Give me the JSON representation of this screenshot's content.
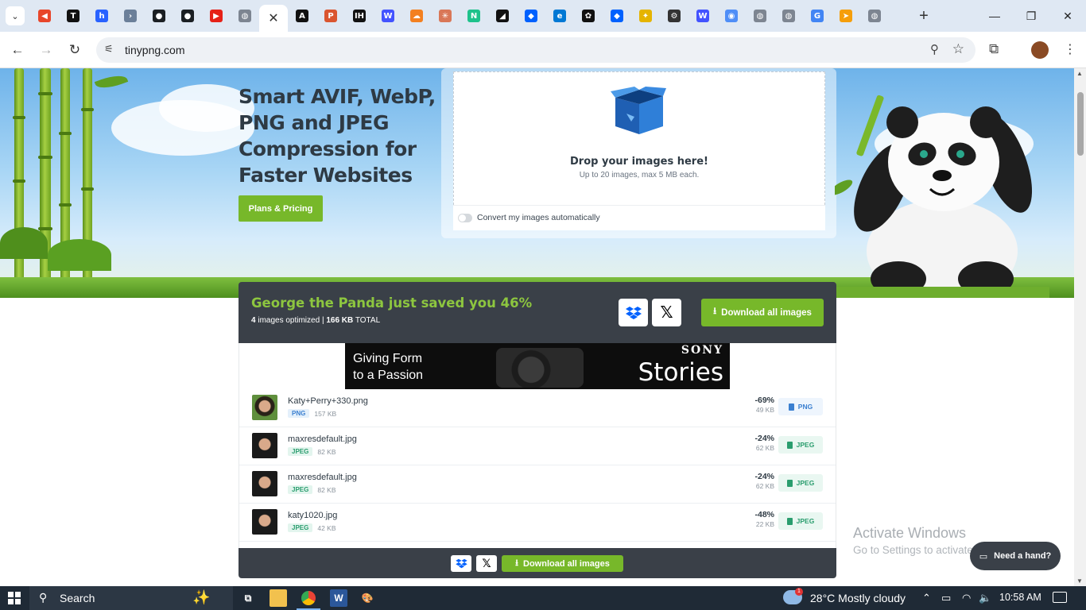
{
  "browser": {
    "tabs": [
      {
        "icon": "tab-menu-icon",
        "glyph": "⌄",
        "color": "#ffffff"
      },
      {
        "icon": "bookmark-red-icon",
        "glyph": "◀",
        "color": "#e8462a"
      },
      {
        "icon": "tabnine-icon",
        "glyph": "T",
        "color": "#111111"
      },
      {
        "icon": "hashnode-icon",
        "glyph": "h",
        "color": "#2962ff"
      },
      {
        "icon": "chevron-icon",
        "glyph": "›",
        "color": "#6b7f99"
      },
      {
        "icon": "github-icon",
        "glyph": "●",
        "color": "#1b1f23"
      },
      {
        "icon": "github-icon",
        "glyph": "●",
        "color": "#1b1f23"
      },
      {
        "icon": "youtube-icon",
        "glyph": "▶",
        "color": "#e62117"
      },
      {
        "icon": "globe-icon",
        "glyph": "◍",
        "color": "#7d8591"
      },
      {
        "icon": "x-icon",
        "glyph": "X",
        "color": "#000000"
      },
      {
        "icon": "anthropic-icon",
        "glyph": "A",
        "color": "#111111"
      },
      {
        "icon": "producthunt-icon",
        "glyph": "P",
        "color": "#da552f"
      },
      {
        "icon": "indiehackers-icon",
        "glyph": "IH",
        "color": "#111111"
      },
      {
        "icon": "webflow-icon",
        "glyph": "W",
        "color": "#4353ff"
      },
      {
        "icon": "cloud-orange-icon",
        "glyph": "☁",
        "color": "#f38020"
      },
      {
        "icon": "asterisk-icon",
        "glyph": "✳",
        "color": "#d97757"
      },
      {
        "icon": "n-logo-icon",
        "glyph": "N",
        "color": "#1ec28b"
      },
      {
        "icon": "slash-icon",
        "glyph": "◢",
        "color": "#111111"
      },
      {
        "icon": "dropbox-icon",
        "glyph": "◆",
        "color": "#0061fe"
      },
      {
        "icon": "edge-icon",
        "glyph": "e",
        "color": "#0078d4"
      },
      {
        "icon": "openai-icon",
        "glyph": "✿",
        "color": "#111111"
      },
      {
        "icon": "dropbox-icon",
        "glyph": "◆",
        "color": "#0061fe"
      },
      {
        "icon": "wand-icon",
        "glyph": "✦",
        "color": "#e5b400"
      },
      {
        "icon": "gear-icon",
        "glyph": "⚙",
        "color": "#333333"
      },
      {
        "icon": "webflow-icon",
        "glyph": "W",
        "color": "#4353ff"
      },
      {
        "icon": "browser-icon",
        "glyph": "◉",
        "color": "#4f8ef7"
      },
      {
        "icon": "globe-icon",
        "glyph": "◍",
        "color": "#7d8591"
      },
      {
        "icon": "globe-icon",
        "glyph": "◍",
        "color": "#7d8591"
      },
      {
        "icon": "google-icon",
        "glyph": "G",
        "color": "#4285f4"
      },
      {
        "icon": "arrow-orange-icon",
        "glyph": "➤",
        "color": "#f59e0b"
      },
      {
        "icon": "globe-icon",
        "glyph": "◍",
        "color": "#7d8591"
      }
    ],
    "active_tab_index": 8,
    "url": "tinypng.com"
  },
  "hero": {
    "headline": "Smart AVIF, WebP, PNG and JPEG Compression for Faster Websites",
    "plans_button": "Plans & Pricing",
    "drop_title": "Drop your images here!",
    "drop_subtitle": "Up to 20 images, max 5 MB each.",
    "convert_label": "Convert my images automatically"
  },
  "results": {
    "title": "George the Panda just saved you 46%",
    "images_count": "4",
    "images_label": "images optimized",
    "total_size": "166 KB",
    "total_label": "TOTAL",
    "download_all": "Download all images",
    "ad": {
      "line1": "Giving Form",
      "line2": "to a Passion",
      "brand": "SONY",
      "tagline": "Stories"
    },
    "files": [
      {
        "name": "Katy+Perry+330.png",
        "type": "PNG",
        "orig": "157 KB",
        "saving": "-69%",
        "new_size": "49 KB",
        "dl": "PNG"
      },
      {
        "name": "maxresdefault.jpg",
        "type": "JPEG",
        "orig": "82 KB",
        "saving": "-24%",
        "new_size": "62 KB",
        "dl": "JPEG"
      },
      {
        "name": "maxresdefault.jpg",
        "type": "JPEG",
        "orig": "82 KB",
        "saving": "-24%",
        "new_size": "62 KB",
        "dl": "JPEG"
      },
      {
        "name": "katy1020.jpg",
        "type": "JPEG",
        "orig": "42 KB",
        "saving": "-48%",
        "new_size": "22 KB",
        "dl": "JPEG"
      }
    ]
  },
  "overlay": {
    "activate_title": "Activate Windows",
    "activate_sub": "Go to Settings to activate Windows.",
    "help": "Need a hand?"
  },
  "taskbar": {
    "search": "Search",
    "weather_temp": "28°C",
    "weather_desc": "Mostly cloudy",
    "weather_badge": "1",
    "time": "10:58 AM"
  },
  "colors": {
    "brand_green": "#77b82a",
    "title_green": "#8dc63f",
    "panel_dark": "#3a4048"
  }
}
